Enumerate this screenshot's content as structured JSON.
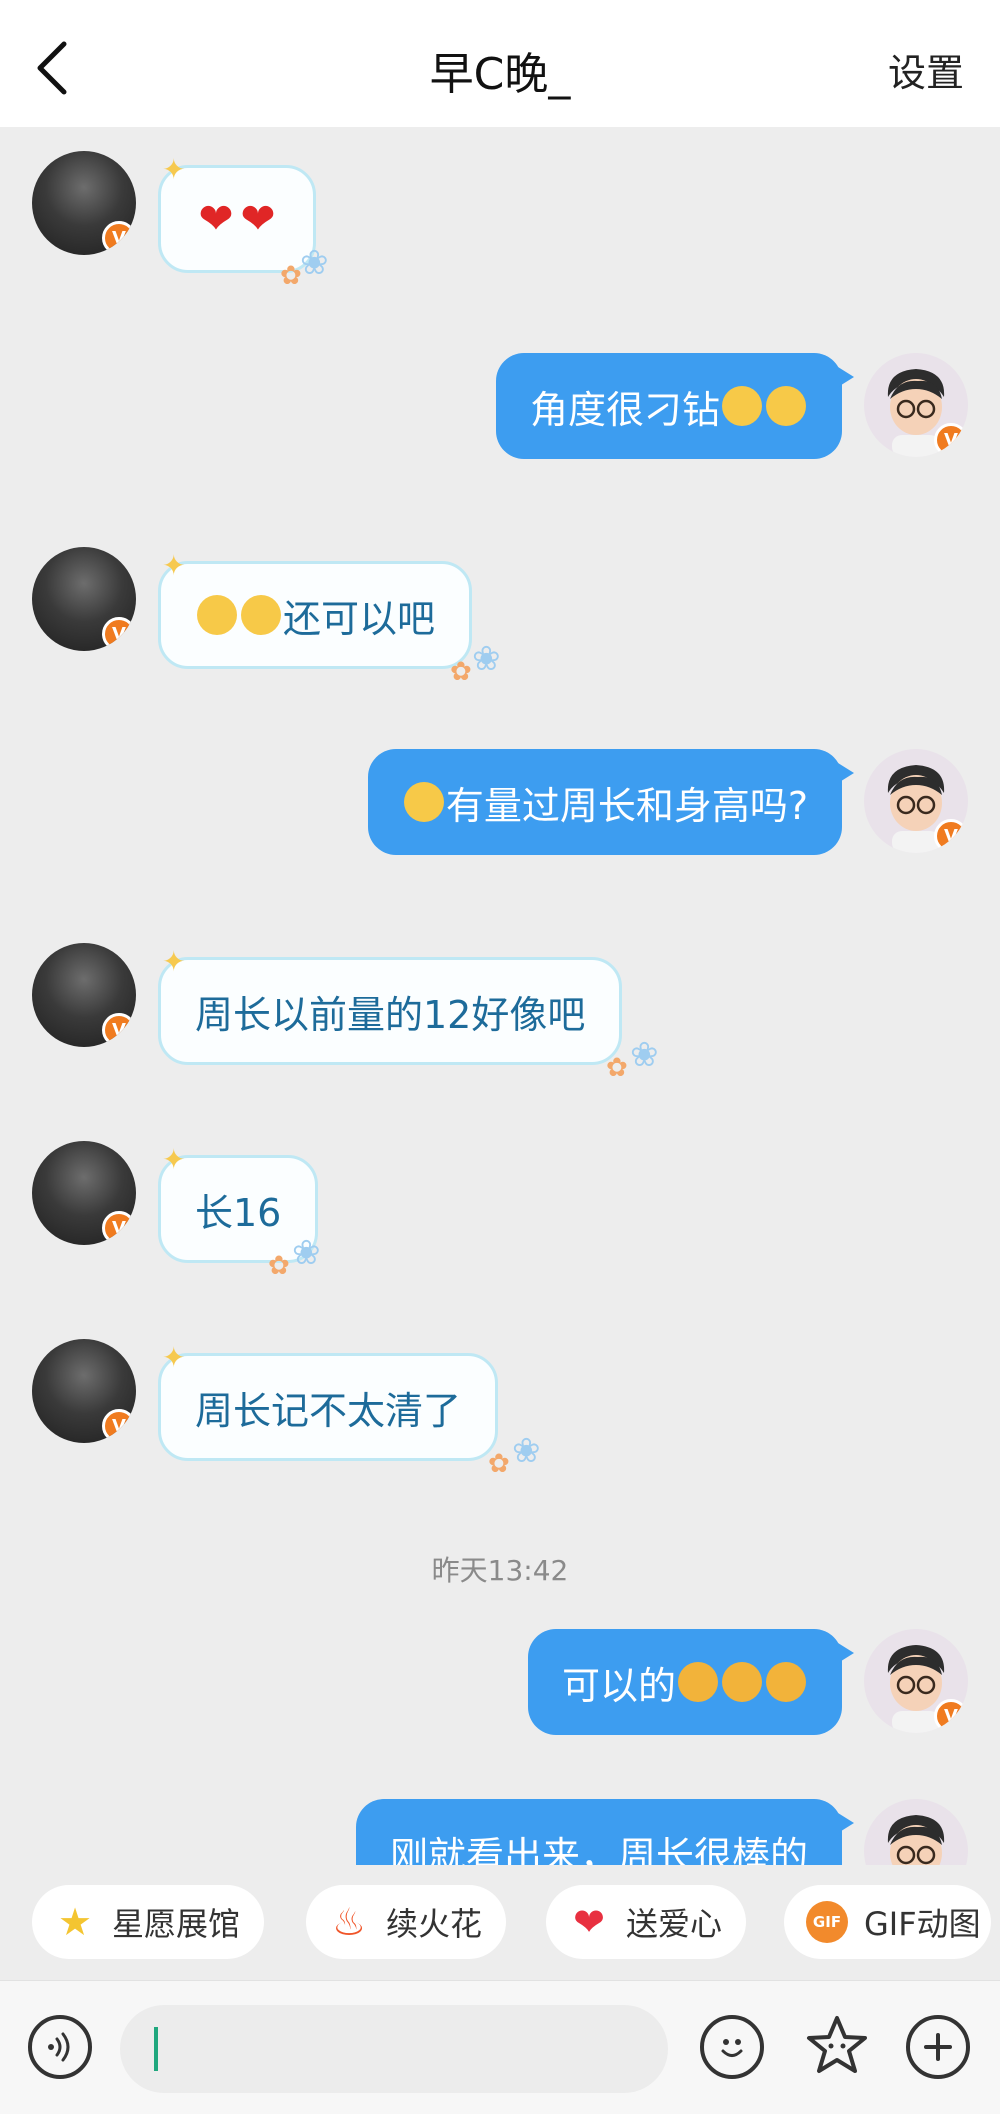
{
  "header": {
    "title": "早C晚_",
    "settings_label": "设置"
  },
  "messages": [
    {
      "side": "in",
      "text": "",
      "emojis": [
        "heart",
        "heart"
      ]
    },
    {
      "side": "out",
      "text": "角度很刁钻",
      "emojis_after": [
        "hold",
        "hold"
      ]
    },
    {
      "side": "in",
      "text": "还可以吧",
      "emojis_before": [
        "grin",
        "grin"
      ]
    },
    {
      "side": "out",
      "text": "有量过周长和身高吗?",
      "emojis_before": [
        "love"
      ]
    },
    {
      "side": "in",
      "text": "周长以前量的12好像吧"
    },
    {
      "side": "in",
      "text": "长16"
    },
    {
      "side": "in",
      "text": "周长记不太清了"
    },
    {
      "side": "out",
      "text": "可以的",
      "emojis_after": [
        "tongue",
        "tongue",
        "tongue"
      ]
    },
    {
      "side": "out",
      "text": "刚就看出来，周长很棒的"
    }
  ],
  "timestamp": "昨天13:42",
  "quick_actions": [
    {
      "label": "星愿展馆",
      "icon": "star-icon"
    },
    {
      "label": "续火花",
      "icon": "fire-icon"
    },
    {
      "label": "送爱心",
      "icon": "heart-icon"
    },
    {
      "label": "GIF动图",
      "icon": "gif-icon"
    }
  ],
  "gif_badge": "GIF",
  "input": {
    "value": ""
  },
  "badge_letter": "V",
  "colors": {
    "outgoing_bubble": "#3d9df0",
    "incoming_bubble_border": "#bfe8f4",
    "incoming_text": "#1d6b9a",
    "badge": "#f07b1f",
    "caret": "#1fa77d"
  }
}
